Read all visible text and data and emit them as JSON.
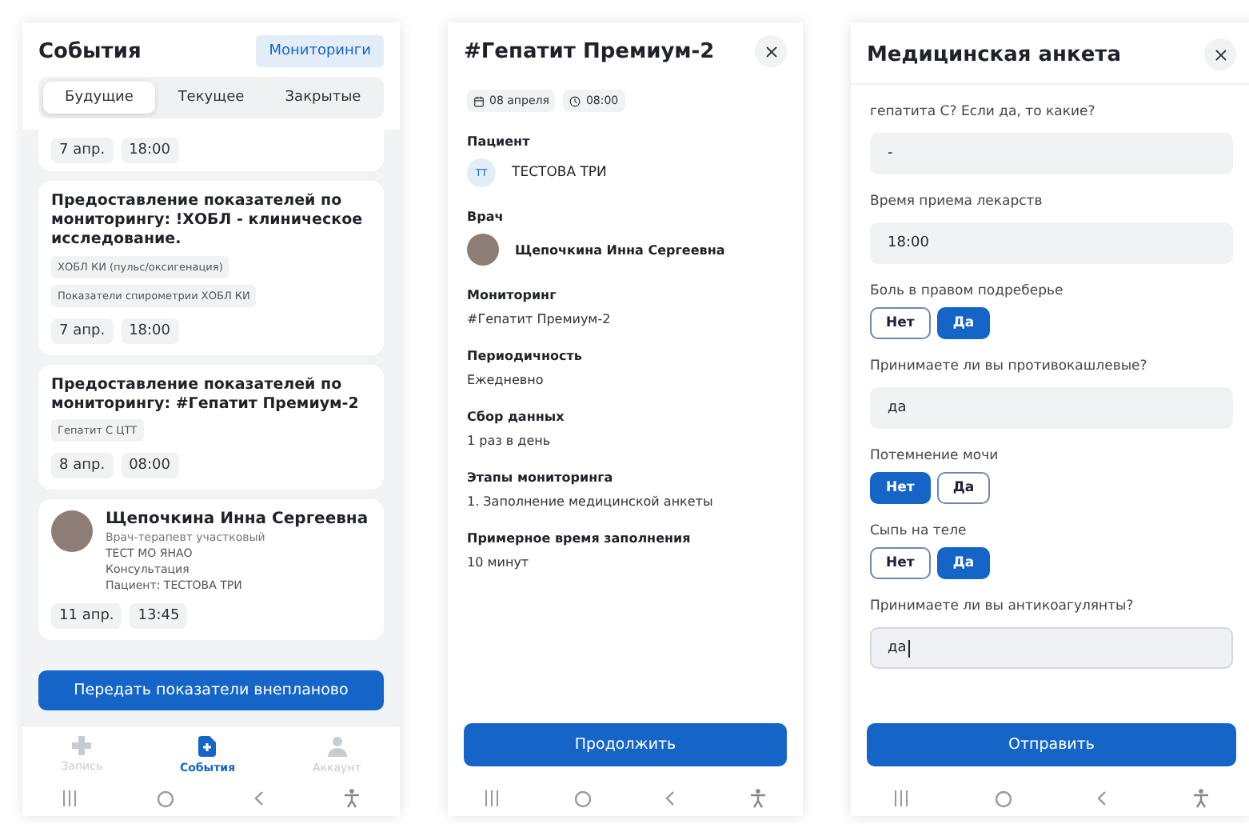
{
  "events_screen": {
    "title": "События",
    "monitoring_button": "Мониторинги",
    "tabs": [
      {
        "label": "Будущие",
        "selected": true
      },
      {
        "label": "Текущее",
        "selected": false
      },
      {
        "label": "Закрытые",
        "selected": false
      }
    ],
    "cards": [
      {
        "kind": "partial",
        "date": "7 апр.",
        "time": "18:00"
      },
      {
        "kind": "monitoring",
        "title": "Предоставление показателей по мониторингу: !ХОБЛ - клиническое исследование.",
        "tags": [
          "ХОБЛ КИ (пульс/оксигенация)",
          "Показатели спирометрии ХОБЛ КИ"
        ],
        "date": "7 апр.",
        "time": "18:00"
      },
      {
        "kind": "monitoring",
        "title": "Предоставление показателей по мониторингу: #Гепатит Премиум-2",
        "tags": [
          "Гепатит С ЦТТ"
        ],
        "date": "8 апр.",
        "time": "08:00"
      },
      {
        "kind": "consultation",
        "doctor": "Щепочкина Инна Сергеевна",
        "lines": [
          "Врач-терапевт участковый",
          "ТЕСТ МО ЯНАО",
          "Консультация",
          "Пациент: ТЕСТОВА ТРИ"
        ],
        "date": "11 апр.",
        "time": "13:45"
      }
    ],
    "action_button": "Передать показатели внепланово",
    "bottom_nav": [
      {
        "kind": "booking",
        "label": "Запись",
        "selected": false
      },
      {
        "kind": "events",
        "label": "События",
        "selected": true
      },
      {
        "kind": "account",
        "label": "Аккаунт",
        "selected": false
      }
    ]
  },
  "detail_screen": {
    "title": "#Гепатит Премиум-2",
    "date": "08 апреля",
    "time": "08:00",
    "patient": {
      "label": "Пациент",
      "initials": "ТТ",
      "name": "ТЕСТОВА ТРИ"
    },
    "doctor": {
      "label": "Врач",
      "name": "Щепочкина Инна Сергеевна"
    },
    "fields": [
      {
        "label": "Мониторинг",
        "value": "#Гепатит Премиум-2"
      },
      {
        "label": "Периодичность",
        "value": "Ежедневно"
      },
      {
        "label": "Сбор данных",
        "value": "1 раз в день"
      },
      {
        "label": "Этапы мониторинга",
        "value": "1. Заполнение медицинской анкеты"
      },
      {
        "label": "Примерное время заполнения",
        "value": "10 минут"
      }
    ],
    "button": "Продолжить"
  },
  "form_screen": {
    "title": "Медицинская анкета",
    "questions": [
      {
        "kind": "text",
        "label": "гепатита С? Если да, то какие?",
        "value": "-",
        "focused": false
      },
      {
        "kind": "text",
        "label": "Время приема лекарств",
        "value": "18:00",
        "focused": false
      },
      {
        "kind": "choice",
        "label": "Боль в правом подреберье",
        "options": [
          {
            "label": "Нет",
            "selected": false
          },
          {
            "label": "Да",
            "selected": true
          }
        ]
      },
      {
        "kind": "text",
        "label": "Принимаете ли вы противокашлевые?",
        "value": "да",
        "focused": false
      },
      {
        "kind": "choice",
        "label": "Потемнение мочи",
        "options": [
          {
            "label": "Нет",
            "selected": true
          },
          {
            "label": "Да",
            "selected": false
          }
        ]
      },
      {
        "kind": "choice",
        "label": "Сыпь на теле",
        "options": [
          {
            "label": "Нет",
            "selected": false
          },
          {
            "label": "Да",
            "selected": true
          }
        ]
      },
      {
        "kind": "text",
        "label": "Принимаете ли вы антикоагулянты?",
        "value": "да",
        "focused": true
      }
    ],
    "button": "Отправить"
  }
}
